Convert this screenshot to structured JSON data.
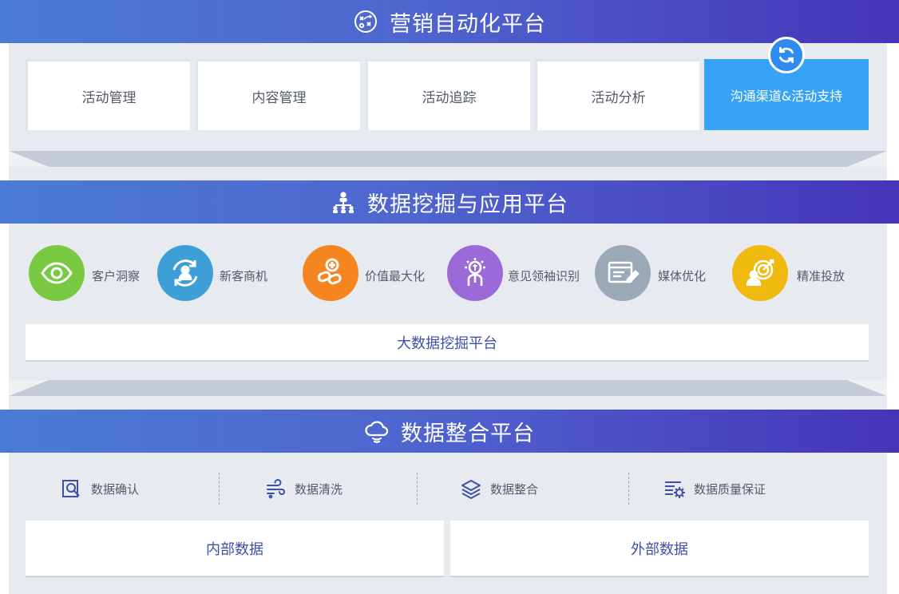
{
  "sections": {
    "marketing": {
      "title": "营销自动化平台",
      "items": [
        "活动管理",
        "内容管理",
        "活动追踪",
        "活动分析",
        "沟通渠道&活动支持"
      ]
    },
    "mining": {
      "title": "数据挖掘与应用平台",
      "apps": [
        {
          "label": "客户洞察",
          "color": "#7ac943",
          "icon": "eye-icon"
        },
        {
          "label": "新客商机",
          "color": "#3d9ed8",
          "icon": "people-cycle-icon"
        },
        {
          "label": "价值最大化",
          "color": "#f5861f",
          "icon": "link-plus-icon"
        },
        {
          "label": "意见领袖识别",
          "color": "#9b6ad8",
          "icon": "leader-bulb-icon"
        },
        {
          "label": "媒体优化",
          "color": "#9aa8b8",
          "icon": "media-edit-icon"
        },
        {
          "label": "精准投放",
          "color": "#f0b90f",
          "icon": "target-person-icon"
        }
      ],
      "platform": "大数据挖掘平台"
    },
    "integration": {
      "title": "数据整合平台",
      "steps": [
        {
          "label": "数据确认",
          "icon": "search-doc-icon"
        },
        {
          "label": "数据清洗",
          "icon": "wind-icon"
        },
        {
          "label": "数据整合",
          "icon": "layers-icon"
        },
        {
          "label": "数据质量保证",
          "icon": "settings-list-icon"
        }
      ],
      "sources": [
        "内部数据",
        "外部数据"
      ]
    }
  },
  "colors": {
    "banner_start": "#4a7bd6",
    "banner_end": "#4634b9",
    "panel": "#e7eaef",
    "active_box": "#36a3f7",
    "text_blue": "#3d4fa8"
  }
}
